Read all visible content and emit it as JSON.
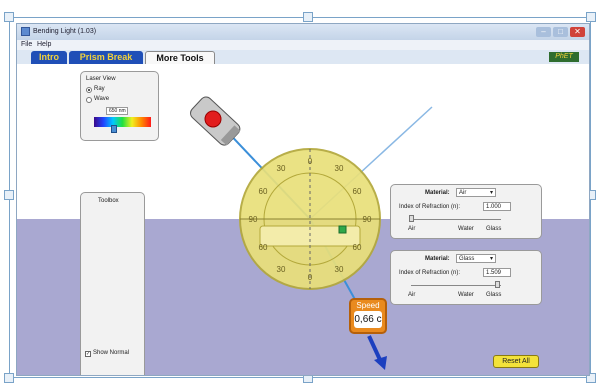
{
  "window": {
    "title": "Bending Light (1.03)",
    "buttons": {
      "minimize": "–",
      "maximize": "□",
      "close": "✕"
    }
  },
  "menu": {
    "file": "File",
    "help": "Help"
  },
  "tabs": [
    {
      "label": "Intro",
      "active": false
    },
    {
      "label": "Prism Break",
      "active": false
    },
    {
      "label": "More Tools",
      "active": true
    }
  ],
  "brand": {
    "logo_text": "PhET"
  },
  "laser_view": {
    "title": "Laser View",
    "options": [
      {
        "label": "Ray",
        "selected": true
      },
      {
        "label": "Wave",
        "selected": false
      }
    ],
    "wavelength": "650 nm"
  },
  "toolbox": {
    "title": "Toolbox",
    "show_normal_label": "Show Normal",
    "show_normal_checked": true
  },
  "upper_medium": {
    "material_label": "Material:",
    "material_value": "Air",
    "index_label": "Index of Refraction (n):",
    "index_value": "1.000",
    "scale_labels": [
      "Air",
      "Water",
      "Glass"
    ]
  },
  "lower_medium": {
    "material_label": "Material:",
    "material_value": "Glass",
    "index_label": "Index of Refraction (n):",
    "index_value": "1.509",
    "scale_labels": [
      "Air",
      "Water",
      "Glass"
    ]
  },
  "protractor": {
    "angle_labels": [
      "0",
      "30",
      "60",
      "90",
      "60",
      "30",
      "0",
      "30",
      "60",
      "90",
      "60",
      "30"
    ]
  },
  "speed": {
    "label": "Speed",
    "value": "0,66 c"
  },
  "reset_button": "Reset All",
  "colors": {
    "upper_medium": "#ffffff",
    "lower_medium": "#a9a8d1",
    "laser_beam": "#3b8fd9",
    "protractor": "#e9e07a",
    "speed_box": "#e98a1e",
    "tab_inactive": "#1f4fb7",
    "tab_text": "#f2d23a",
    "reset_button": "#f3e23a"
  },
  "icons": [
    "laser-pointer-icon",
    "intensity-meter-icon",
    "velocity-sensor-icon",
    "protractor-icon",
    "wave-sensor-icon"
  ]
}
